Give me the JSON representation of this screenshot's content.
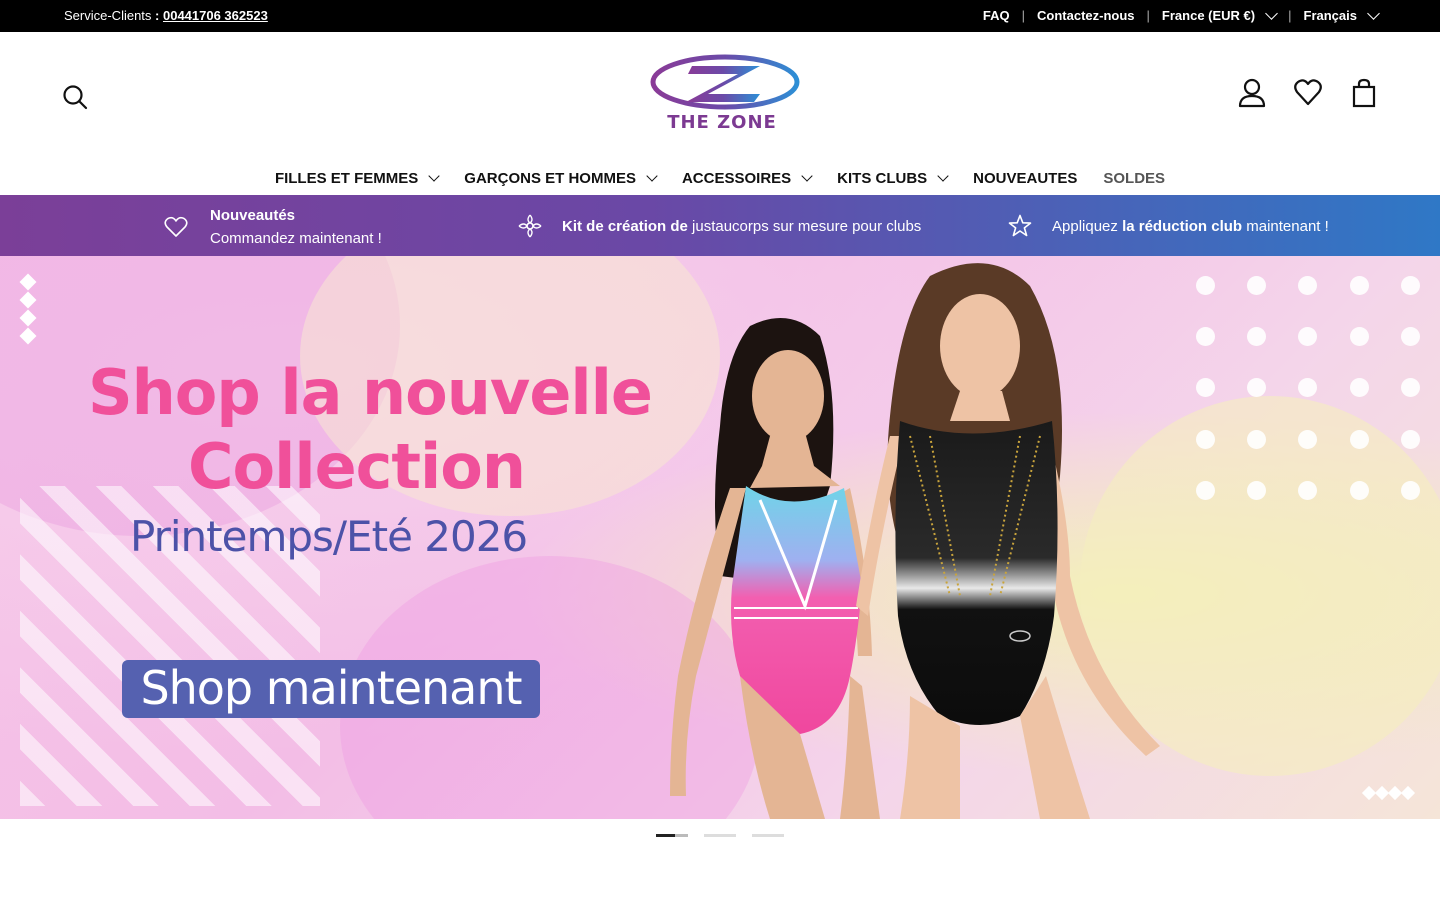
{
  "topbar": {
    "service_label": "Service-Clients",
    "service_colon": " : ",
    "phone": "00441706 362523",
    "links": [
      "FAQ",
      "Contactez-nous"
    ],
    "country": "France (EUR €)",
    "language": "Français"
  },
  "header": {
    "logo_text": "THE ZONE"
  },
  "nav": {
    "items": [
      "FILLES ET FEMMES",
      "GARÇONS ET HOMMES",
      "ACCESSOIRES",
      "KITS CLUBS",
      "NOUVEAUTES",
      "SOLDES"
    ]
  },
  "promo": {
    "p1_title": "Nouveautés",
    "p1_sub": "Commandez maintenant !",
    "p2_bold": "Kit de création de",
    "p2_rest": " justaucorps sur mesure pour clubs",
    "p3_pre": "Appliquez ",
    "p3_bold": "la réduction club",
    "p3_post": " maintenant !"
  },
  "hero": {
    "title_line1": "Shop la nouvelle",
    "title_line2": "Collection",
    "subtitle": "Printemps/Eté 2026",
    "cta": "Shop maintenant"
  },
  "slider": {
    "count": 3,
    "active": 1
  },
  "colors": {
    "accent_pink": "#f0509a",
    "accent_indigo": "#5561b0",
    "promo_start": "#7b3f98",
    "promo_end": "#2f78c6"
  }
}
